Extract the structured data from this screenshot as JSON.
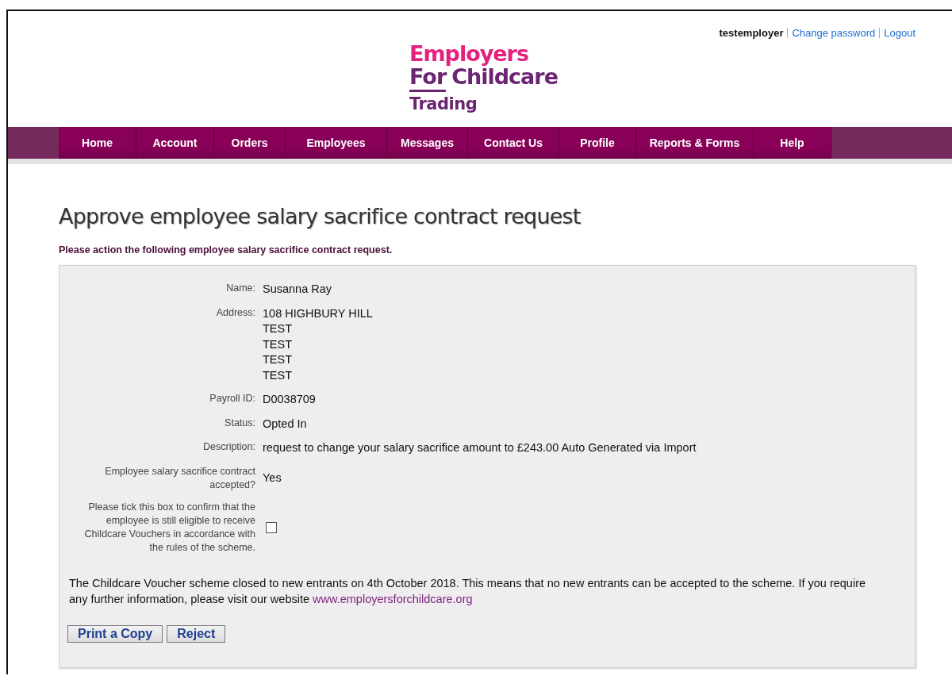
{
  "user_bar": {
    "username": "testemployer",
    "links": [
      {
        "label": "Change password"
      },
      {
        "label": "Logout"
      }
    ]
  },
  "logo": {
    "line_1": "Employers",
    "line_2_underlined": "For",
    "line_2_rest": "Childcare",
    "line_3": "Trading"
  },
  "nav": [
    {
      "label": "Home"
    },
    {
      "label": "Account"
    },
    {
      "label": "Orders"
    },
    {
      "label": "Employees"
    },
    {
      "label": "Messages"
    },
    {
      "label": "Contact Us"
    },
    {
      "label": "Profile"
    },
    {
      "label": "Reports & Forms"
    },
    {
      "label": "Help"
    }
  ],
  "page": {
    "title": "Approve employee salary sacrifice contract request",
    "subtitle": "Please action the following employee salary sacrifice contract request."
  },
  "fields": [
    {
      "kind": "text",
      "label": "Name:",
      "lines": [
        "Susanna Ray"
      ]
    },
    {
      "kind": "text",
      "label": "Address:",
      "lines": [
        "108 HIGHBURY HILL",
        "TEST",
        "TEST",
        "TEST",
        "TEST"
      ]
    },
    {
      "kind": "text",
      "label": "Payroll ID:",
      "lines": [
        "D0038709"
      ]
    },
    {
      "kind": "text",
      "label": "Status:",
      "lines": [
        "Opted In"
      ]
    },
    {
      "kind": "text",
      "label": "Description:",
      "lines": [
        "request to change your salary sacrifice amount to £243.00 Auto Generated via Import"
      ]
    },
    {
      "kind": "text",
      "label": "Employee salary sacrifice contract accepted?",
      "lines": [
        "Yes"
      ]
    },
    {
      "kind": "checkbox",
      "label": "Please tick this box to confirm that the employee is still eligible to receive Childcare Vouchers in accordance with the rules of the scheme.",
      "checked": false
    }
  ],
  "notice": {
    "text": "The Childcare Voucher scheme closed to new entrants on 4th October 2018. This means that no new entrants can be accepted to the scheme. If you require any further information, please visit our website",
    "link": "www.employersforchildcare.org"
  },
  "buttons": [
    {
      "label": "Print a Copy"
    },
    {
      "label": "Reject"
    }
  ]
}
